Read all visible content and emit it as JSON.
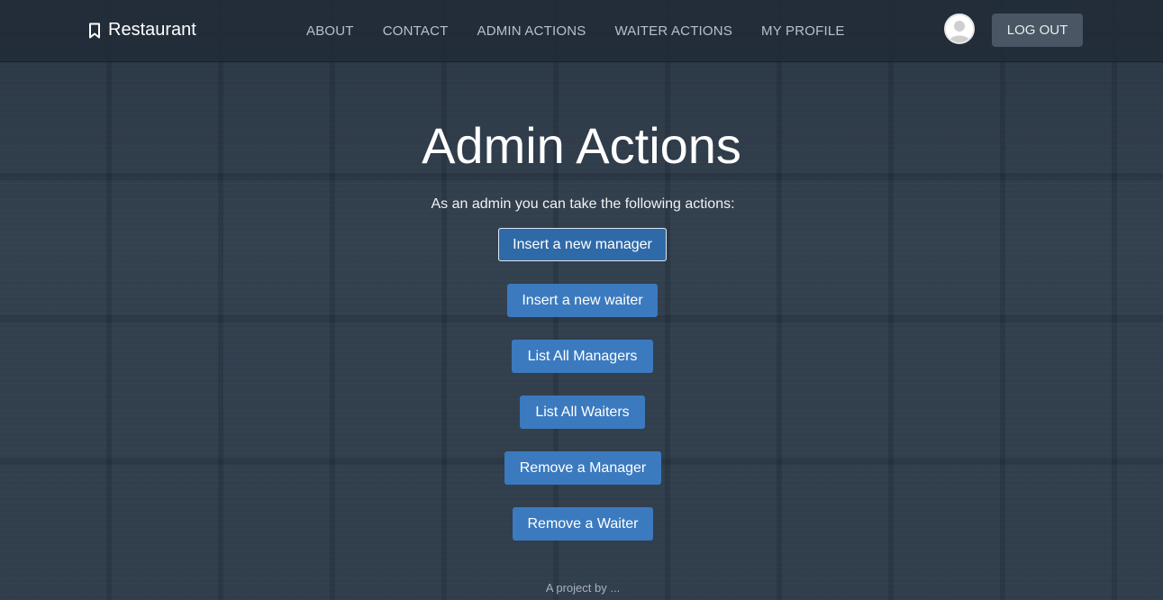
{
  "navbar": {
    "brand": "Restaurant",
    "brand_icon": "bookmark-icon",
    "links": [
      "ABOUT",
      "CONTACT",
      "ADMIN ACTIONS",
      "WAITER ACTIONS",
      "MY PROFILE"
    ],
    "avatar_icon": "user-avatar-icon",
    "logout_label": "LOG OUT"
  },
  "main": {
    "title": "Admin Actions",
    "subtitle": "As an admin you can take the following actions:",
    "actions": [
      "Insert a new manager",
      "Insert a new waiter",
      "List All Managers",
      "List All Waiters",
      "Remove a Manager",
      "Remove a Waiter"
    ]
  },
  "footer": {
    "text": "A project by ..."
  },
  "colors": {
    "button": "#3b7abf",
    "background": "#2f3e4d",
    "navbar": "#222c38"
  }
}
